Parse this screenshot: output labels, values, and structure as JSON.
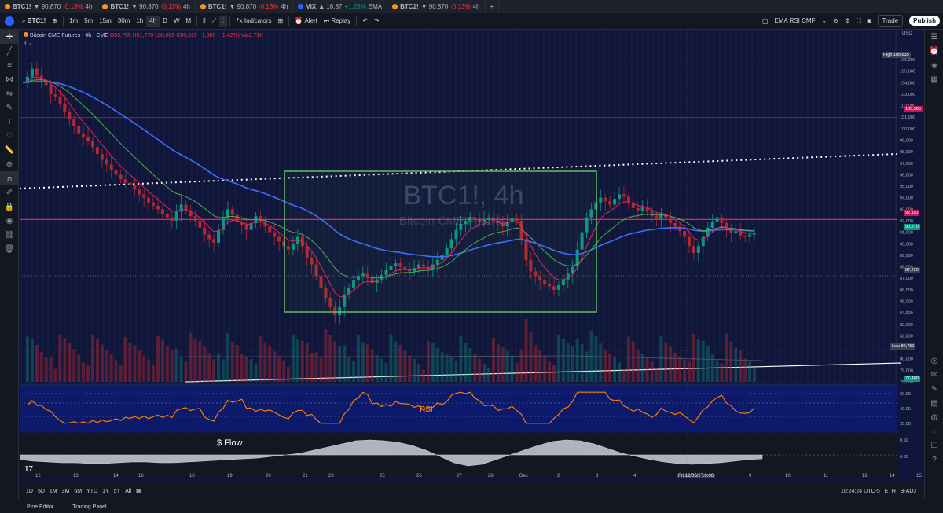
{
  "tabs": [
    {
      "symbol": "BTC1!",
      "price": "▼ 90,870",
      "change": "-0.13%",
      "suffix": "4h"
    },
    {
      "symbol": "BTC1!",
      "price": "▼ 90,870",
      "change": "-0.13%",
      "suffix": "4h"
    },
    {
      "symbol": "BTC1!",
      "price": "▼ 90,870",
      "change": "-0.13%",
      "suffix": "4h"
    },
    {
      "symbol": "VIX",
      "price": "▲ 16.87",
      "change": "+1.26%",
      "suffix": "EMA"
    },
    {
      "symbol": "BTC1!",
      "price": "▼ 90,870",
      "change": "-0.13%",
      "suffix": "4h"
    }
  ],
  "toolbar": {
    "symbol": "BTC1!",
    "intervals": [
      "1m",
      "5m",
      "15m",
      "30m",
      "1h",
      "4h",
      "D",
      "W",
      "M"
    ],
    "selected_interval": "4h",
    "indicators_label": "Indicators",
    "alert_label": "Alert",
    "replay_label": "Replay",
    "layout_name": "EMA RSI CMF",
    "trade_label": "Trade",
    "publish_label": "Publish"
  },
  "legend": {
    "title": "Bitcoin CME Futures · 4h · CME",
    "ohlc": "O93,785 H91,770 L88,605 C89,315 −1,385 (−1.42%) Vol2.71K",
    "sub": "4"
  },
  "currency": "USD",
  "watermark": {
    "symbol": "BTC1!, 4h",
    "name": "Bitcoin CME Futures"
  },
  "price_scale": [
    "106,000",
    "105,000",
    "104,000",
    "103,000",
    "102,000",
    "101,000",
    "100,000",
    "99,000",
    "98,000",
    "97,000",
    "96,000",
    "95,000",
    "94,000",
    "93,000",
    "92,000",
    "91,000",
    "90,000",
    "89,000",
    "88,000",
    "87,000",
    "86,000",
    "85,000",
    "84,000",
    "83,000",
    "82,000",
    "81,000",
    "80,000",
    "79,000",
    "78,000"
  ],
  "price_tags": {
    "high_label": "High",
    "high": "105,635",
    "level1": "100,965",
    "level2": "92,110",
    "last": "90,870",
    "level3": "87,220",
    "low_label": "Low",
    "low": "80,750",
    "vol": "77,480"
  },
  "rsi": {
    "label": "RSI",
    "scale": [
      "60.00",
      "40.00",
      "20.00"
    ]
  },
  "flow": {
    "label": "$ Flow",
    "scale": [
      "0.50",
      "0.00"
    ]
  },
  "dates": [
    "12",
    "13",
    "14",
    "16",
    "18",
    "19",
    "20",
    "21",
    "23",
    "25",
    "26",
    "27",
    "28",
    "Dec",
    "2",
    "3",
    "4",
    "Fri 12/05/25",
    "10:00",
    "9",
    "10",
    "11",
    "12",
    "14",
    "15"
  ],
  "ranges": [
    "1D",
    "5D",
    "1M",
    "3M",
    "6M",
    "YTD",
    "1Y",
    "5Y",
    "All"
  ],
  "clock": "10:24:24 UTC-5",
  "session": "ETH",
  "adj": "B-ADJ",
  "footer": {
    "pine": "Pine Editor",
    "panel": "Trading Panel"
  },
  "colors": {
    "up": "#089981",
    "down": "#f23645",
    "ema_fast": "#e91e63",
    "ema_mid": "#4caf50",
    "ema_slow": "#3f6bff",
    "rsi": "#f57c00",
    "box": "#66bb6a"
  }
}
